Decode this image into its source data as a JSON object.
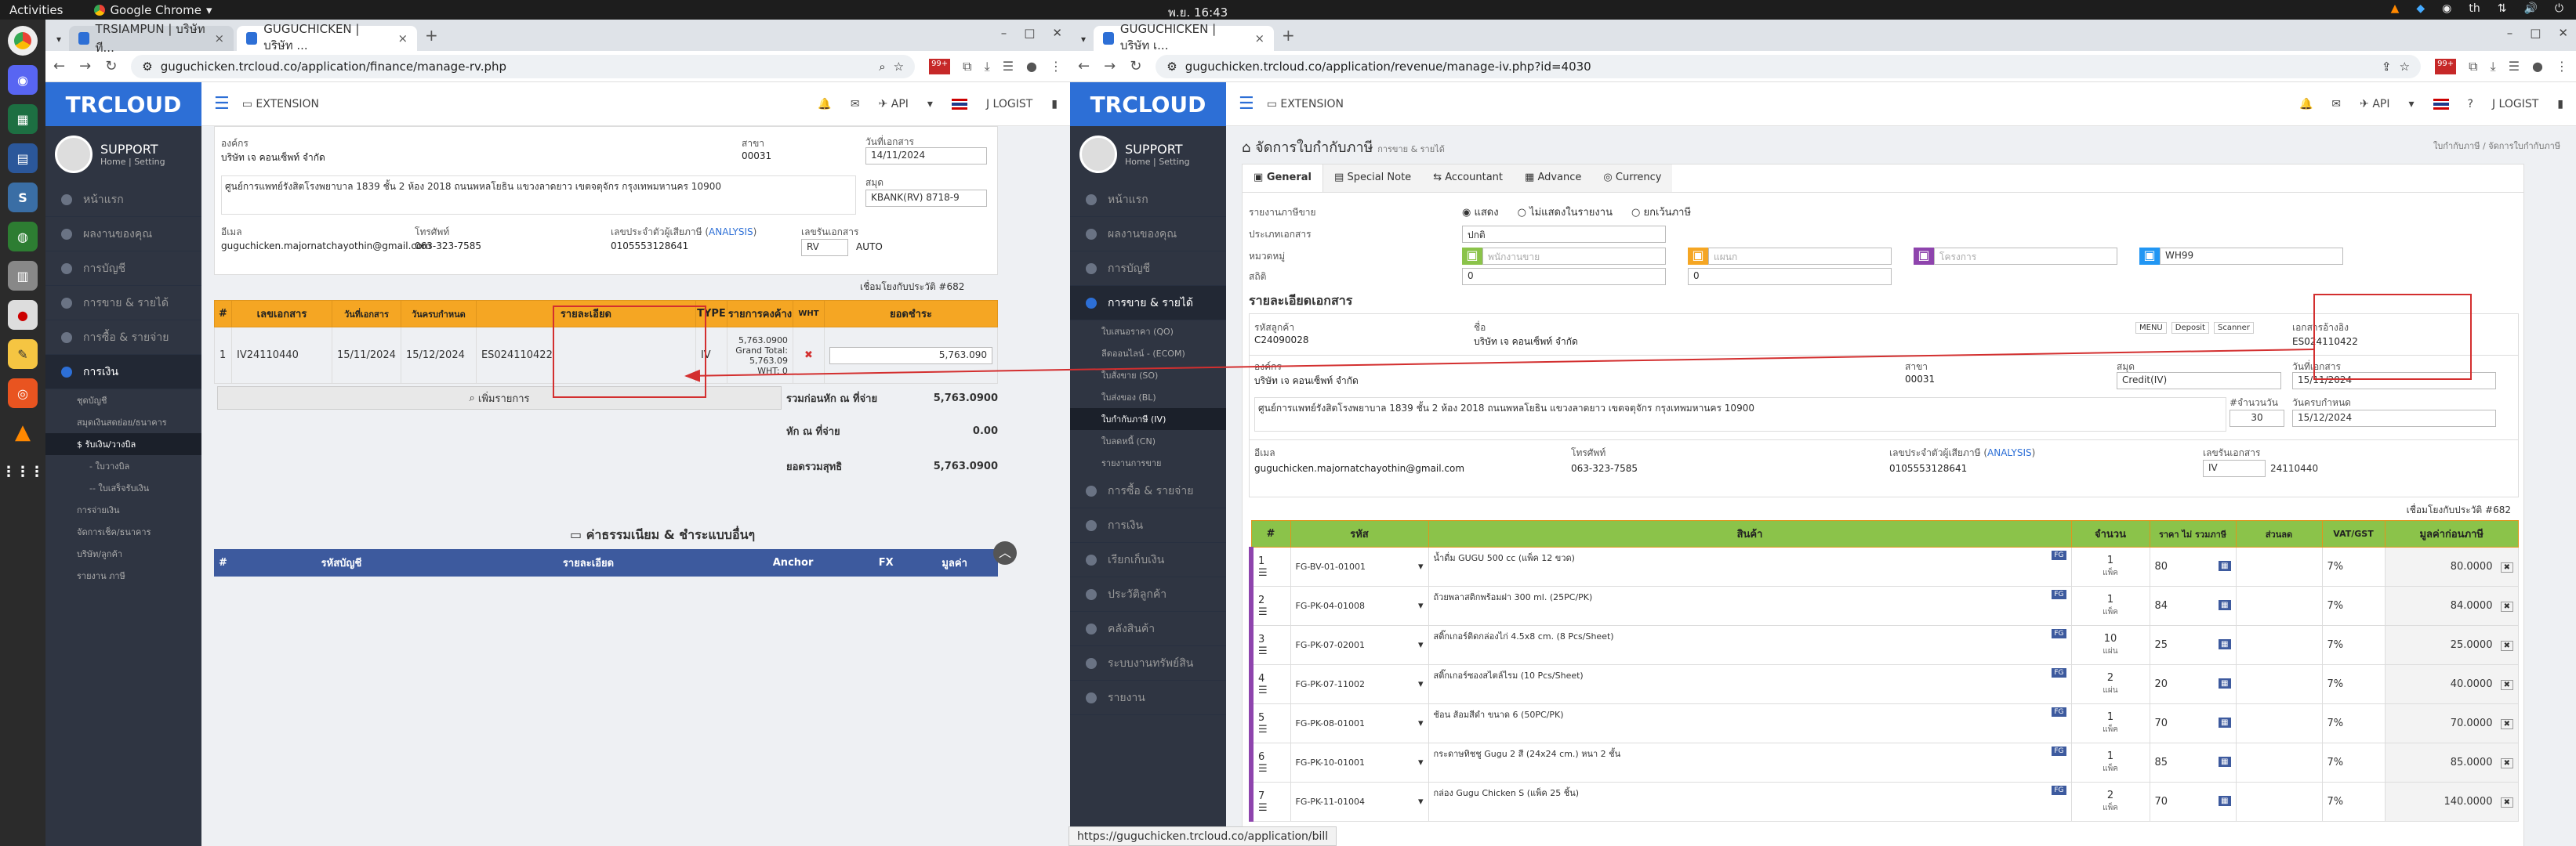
{
  "os": {
    "activities": "Activities",
    "browser": "Google Chrome",
    "clock": "พ.ย. 16:43",
    "lang": "th"
  },
  "left": {
    "tabs": [
      {
        "label": "TRSIAMPUN | บริษัท ที..."
      },
      {
        "label": "GUGUCHICKEN | บริษัท ..."
      }
    ],
    "url": "guguchicken.trcloud.co/application/finance/manage-rv.php",
    "brand": "TRCLOUD",
    "extension": "EXTENSION",
    "api": "API",
    "user": "J LOGIST",
    "support": "SUPPORT",
    "home": "Home",
    "setting": "Setting",
    "menu": [
      {
        "label": "หน้าแรก"
      },
      {
        "label": "ผลงานของคุณ"
      },
      {
        "label": "การบัญชี"
      },
      {
        "label": "การขาย & รายได้"
      },
      {
        "label": "การซื้อ & รายจ่าย"
      },
      {
        "label": "การเงิน"
      }
    ],
    "submenu": [
      {
        "label": "ชุดบัญชี"
      },
      {
        "label": "สมุดเงินสดย่อย/ธนาคาร"
      },
      {
        "label": "$ รับเงิน/วางบิล"
      },
      {
        "label": "- ใบวางบิล"
      },
      {
        "label": "-- ใบเสร็จรับเงิน"
      },
      {
        "label": "การจ่ายเงิน"
      },
      {
        "label": "จัดการเช็ค/ธนาคาร"
      },
      {
        "label": "บริษัท/ลูกค้า"
      },
      {
        "label": "รายงาน ภาษี"
      }
    ],
    "org_label": "องค์กร",
    "org": "บริษัท เจ คอนเซ็พท์ จำกัด",
    "branch_label": "สาขา",
    "branch": "00031",
    "date_label": "วันที่เอกสาร",
    "date": "14/11/2024",
    "address": "ศูนย์การแพทย์รังสิตโรงพยาบาล 1839 ชั้น 2 ห้อง 2018 ถนนพหลโยธิน แขวงลาดยาว เขตจตุจักร กรุงเทพมหานคร 10900",
    "account_label": "สมุด",
    "account": "KBANK(RV) 8718-9",
    "email_label": "อีเมล",
    "email": "guguchicken.majornatchayothin@gmail.com",
    "phone_label": "โทรศัพท์",
    "phone": "063-323-7585",
    "tax_label": "เลขประจำตัวผู้เสียภาษี",
    "analysis": "ANALYSIS",
    "tax": "0105553128641",
    "docno_label": "เลขรันเอกสาร",
    "docprefix": "RV",
    "auto": "AUTO",
    "ref": "เชื่อมโยงกับประวัติ #682",
    "columns": [
      "#",
      "เลขเอกสาร",
      "วันที่เอกสาร",
      "วันครบกำหนด",
      "รายละเอียด",
      "TYPE",
      "รายการคงค้าง",
      "WHT",
      "ยอดชำระ"
    ],
    "row": {
      "no": "1",
      "doc": "IV24110440",
      "date": "15/11/2024",
      "due": "15/12/2024",
      "detail": "ES024110422",
      "type": "IV",
      "outstanding": "5,763.0900",
      "grand": "Grand Total:",
      "grand_val": "5,763.09",
      "wht": "WHT: 0",
      "pay": "5,763.090"
    },
    "add_item": "เพิ่มรายการ",
    "totals": [
      {
        "label": "รวมก่อนหัก ณ ที่จ่าย",
        "value": "5,763.0900"
      },
      {
        "label": "หัก ณ ที่จ่าย",
        "value": "0.00",
        "sub": "0.0000"
      },
      {
        "label": "ยอดรวมสุทธิ",
        "value": "5,763.0900"
      }
    ],
    "fee_title": "ค่าธรรมเนียม & ชำระแบบอื่นๆ",
    "fee_cols": [
      "#",
      "รหัสบัญชี",
      "รายละเอียด",
      "Anchor",
      "FX",
      "มูลค่า"
    ]
  },
  "right": {
    "tab": "GUGUCHICKEN | บริษัท เ...",
    "url": "guguchicken.trcloud.co/application/revenue/manage-iv.php?id=4030",
    "brand": "TRCLOUD",
    "extension": "EXTENSION",
    "api": "API",
    "user": "J LOGIST",
    "support": "SUPPORT",
    "home": "Home",
    "setting": "Setting",
    "menu": [
      {
        "label": "หน้าแรก"
      },
      {
        "label": "ผลงานของคุณ"
      },
      {
        "label": "การบัญชี"
      },
      {
        "label": "การขาย & รายได้"
      }
    ],
    "submenu": [
      {
        "label": "ใบเสนอราคา (QO)"
      },
      {
        "label": "ลีดออนไลน์ - (ECOM)"
      },
      {
        "label": "ใบสั่งขาย (SO)"
      },
      {
        "label": "ใบส่งของ (BL)"
      },
      {
        "label": "ใบกำกับภาษี (IV)"
      },
      {
        "label": "ใบลดหนี้ (CN)"
      },
      {
        "label": "รายงานการขาย"
      }
    ],
    "menu2": [
      {
        "label": "การซื้อ & รายจ่าย"
      },
      {
        "label": "การเงิน"
      },
      {
        "label": "เรียกเก็บเงิน"
      },
      {
        "label": "ประวัติลูกค้า"
      },
      {
        "label": "คลังสินค้า"
      },
      {
        "label": "ระบบงานทรัพย์สิน"
      },
      {
        "label": "รายงาน"
      }
    ],
    "page_title": "จัดการใบกำกับภาษี",
    "page_sub": "การขาย & รายได้",
    "crumbs": "ใบกำกับภาษี / จัดการใบกำกับภาษี",
    "subtabs": [
      "General",
      "Special Note",
      "Accountant",
      "Advance",
      "Currency"
    ],
    "report_label": "รายงานภาษีขาย",
    "radios": [
      "แสดง",
      "ไม่แสดงในรายงาน",
      "ยกเว้นภาษี"
    ],
    "type_label": "ประเภทเอกสาร",
    "type": "ปกติ",
    "group_label": "หมวดหมู่",
    "sales_ph": "พนักงานขาย",
    "dept_ph": "แผนก",
    "project_ph": "โครงการ",
    "wh": "WH99",
    "status_label": "สถิติ",
    "zero1": "0",
    "zero2": "0",
    "section": "รายละเอียดเอกสาร",
    "cust_code_label": "รหัสลูกค้า",
    "cust_code": "C24090028",
    "name_label": "ชื่อ",
    "name": "บริษัท เจ คอนเซ็พท์ จำกัด",
    "mini_btns": [
      "MENU",
      "Deposit",
      "Scanner"
    ],
    "ref_label": "เอกสารอ้างอิง",
    "ref": "ES024110422",
    "org_label": "องค์กร",
    "org": "บริษัท เจ คอนเซ็พท์ จำกัด",
    "branch_label": "สาขา",
    "branch": "00031",
    "ledger_label": "สมุด",
    "ledger": "Credit(IV)",
    "docdate_label": "วันที่เอกสาร",
    "docdate": "15/11/2024",
    "address": "ศูนย์การแพทย์รังสิตโรงพยาบาล 1839 ชั้น 2 ห้อง 2018 ถนนพหลโยธิน แขวงลาดยาว เขตจตุจักร กรุงเทพมหานคร 10900",
    "credit_label": "#จำนวนวัน",
    "credit": "30",
    "due_label": "วันครบกำหนด",
    "due": "15/12/2024",
    "email_label": "อีเมล",
    "email": "guguchicken.majornatchayothin@gmail.com",
    "phone_label": "โทรศัพท์",
    "phone": "063-323-7585",
    "tax_label": "เลขประจำตัวผู้เสียภาษี",
    "analysis": "ANALYSIS",
    "tax": "0105553128641",
    "docno_label": "เลขรันเอกสาร",
    "docprefix": "IV",
    "docno": "24110440",
    "link": "เชื่อมโยงกับประวัติ #682",
    "columns": [
      "#",
      "รหัส",
      "สินค้า",
      "จำนวน",
      "ราคา ไม่ รวมภาษี",
      "ส่วนลด",
      "VAT/GST",
      "มูลค่าก่อนภาษี"
    ],
    "items": [
      {
        "no": "1",
        "code": "FG-BV-01-01001",
        "name": "น้ำดื่ม GUGU 500 cc (แพ็ค 12 ขวด)",
        "qty": "1",
        "unit": "แพ็ค",
        "price": "80",
        "vat": "7%",
        "amount": "80.0000"
      },
      {
        "no": "2",
        "code": "FG-PK-04-01008",
        "name": "ถ้วยพลาสติกพร้อมฝา 300 ml. (25PC/PK)",
        "qty": "1",
        "unit": "แพ็ค",
        "price": "84",
        "vat": "7%",
        "amount": "84.0000"
      },
      {
        "no": "3",
        "code": "FG-PK-07-02001",
        "name": "สติ๊กเกอร์ติดกล่องไก่ 4.5x8 cm. (8 Pcs/Sheet)",
        "qty": "10",
        "unit": "แผ่น",
        "price": "25",
        "vat": "7%",
        "amount": "25.0000"
      },
      {
        "no": "4",
        "code": "FG-PK-07-11002",
        "name": "สติ๊กเกอร์ซองสไตล์ไรม (10 Pcs/Sheet)",
        "qty": "2",
        "unit": "แผ่น",
        "price": "20",
        "vat": "7%",
        "amount": "40.0000"
      },
      {
        "no": "5",
        "code": "FG-PK-08-01001",
        "name": "ช้อน ส้อมสีดำ ขนาด 6 (50PC/PK)",
        "qty": "1",
        "unit": "แพ็ค",
        "price": "70",
        "vat": "7%",
        "amount": "70.0000"
      },
      {
        "no": "6",
        "code": "FG-PK-10-01001",
        "name": "กระดาษทิชชู Gugu 2 สี (24x24 cm.) หนา 2 ชั้น",
        "qty": "1",
        "unit": "แพ็ค",
        "price": "85",
        "vat": "7%",
        "amount": "85.0000"
      },
      {
        "no": "7",
        "code": "FG-PK-11-01004",
        "name": "กล่อง Gugu Chicken S (แพ็ค 25 ชิ้น)",
        "qty": "2",
        "unit": "แพ็ค",
        "price": "70",
        "vat": "7%",
        "amount": "140.0000"
      }
    ]
  },
  "status_url": "https://guguchicken.trcloud.co/application/bill"
}
